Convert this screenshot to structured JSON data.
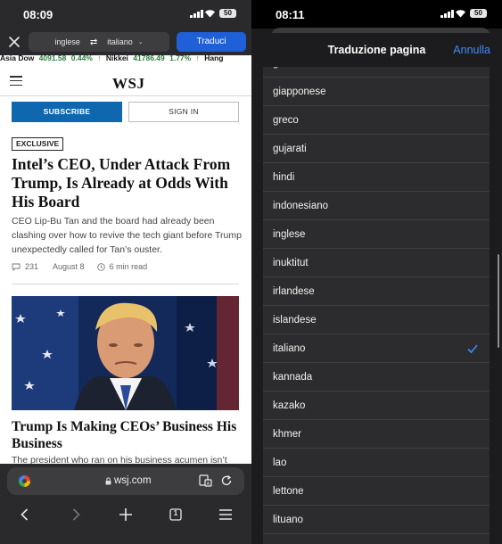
{
  "left_phone": {
    "status": {
      "time": "08:09",
      "battery": "50"
    },
    "translate_bar": {
      "source_lang": "inglese",
      "swap_symbol": "⇄",
      "target_lang": "italiano",
      "translate_button": "Traduci"
    },
    "ticker": [
      {
        "name": "Asia Dow",
        "value": "4091.58",
        "change": "0.44%"
      },
      {
        "name": "Nikkei",
        "value": "41786.49",
        "change": "1.77%"
      },
      {
        "name": "Hang",
        "value": "",
        "change": ""
      }
    ],
    "site": {
      "logo": "WSJ",
      "subscribe_label": "SUBSCRIBE",
      "signin_label": "SIGN IN"
    },
    "article": {
      "badge": "EXCLUSIVE",
      "headline": "Intel’s CEO, Under Attack From Trump, Is Already at Odds With His Board",
      "summary": "CEO Lip-Bu Tan and the board had already been clashing over how to revive the tech giant before Trump unexpectedly called for Tan’s ouster.",
      "comments": "231",
      "date": "August 8",
      "read_time": "6 min read"
    },
    "article2": {
      "headline": "Trump Is Making CEOs’ Business His Business",
      "summary_cut": "The president who ran on his business acumen isn’t"
    },
    "browser": {
      "url": "wsj.com",
      "tab_count": "1"
    }
  },
  "right_phone": {
    "status": {
      "time": "08:11",
      "battery": "50"
    },
    "sheet": {
      "title": "Traduzione pagina",
      "cancel_label": "Annulla",
      "partial_top": "gallese",
      "languages": [
        {
          "label": "giapponese",
          "selected": false
        },
        {
          "label": "greco",
          "selected": false
        },
        {
          "label": "gujarati",
          "selected": false
        },
        {
          "label": "hindi",
          "selected": false
        },
        {
          "label": "indonesiano",
          "selected": false
        },
        {
          "label": "inglese",
          "selected": false
        },
        {
          "label": "inuktitut",
          "selected": false
        },
        {
          "label": "irlandese",
          "selected": false
        },
        {
          "label": "islandese",
          "selected": false
        },
        {
          "label": "italiano",
          "selected": true
        },
        {
          "label": "kannada",
          "selected": false
        },
        {
          "label": "kazako",
          "selected": false
        },
        {
          "label": "khmer",
          "selected": false
        },
        {
          "label": "lao",
          "selected": false
        },
        {
          "label": "lettone",
          "selected": false
        },
        {
          "label": "lituano",
          "selected": false
        }
      ]
    }
  },
  "colors": {
    "accent_blue": "#1f5fd8",
    "link_blue": "#3d8df5",
    "wsj_blue": "#0f67b0",
    "ticker_green": "#2b7a3b"
  }
}
